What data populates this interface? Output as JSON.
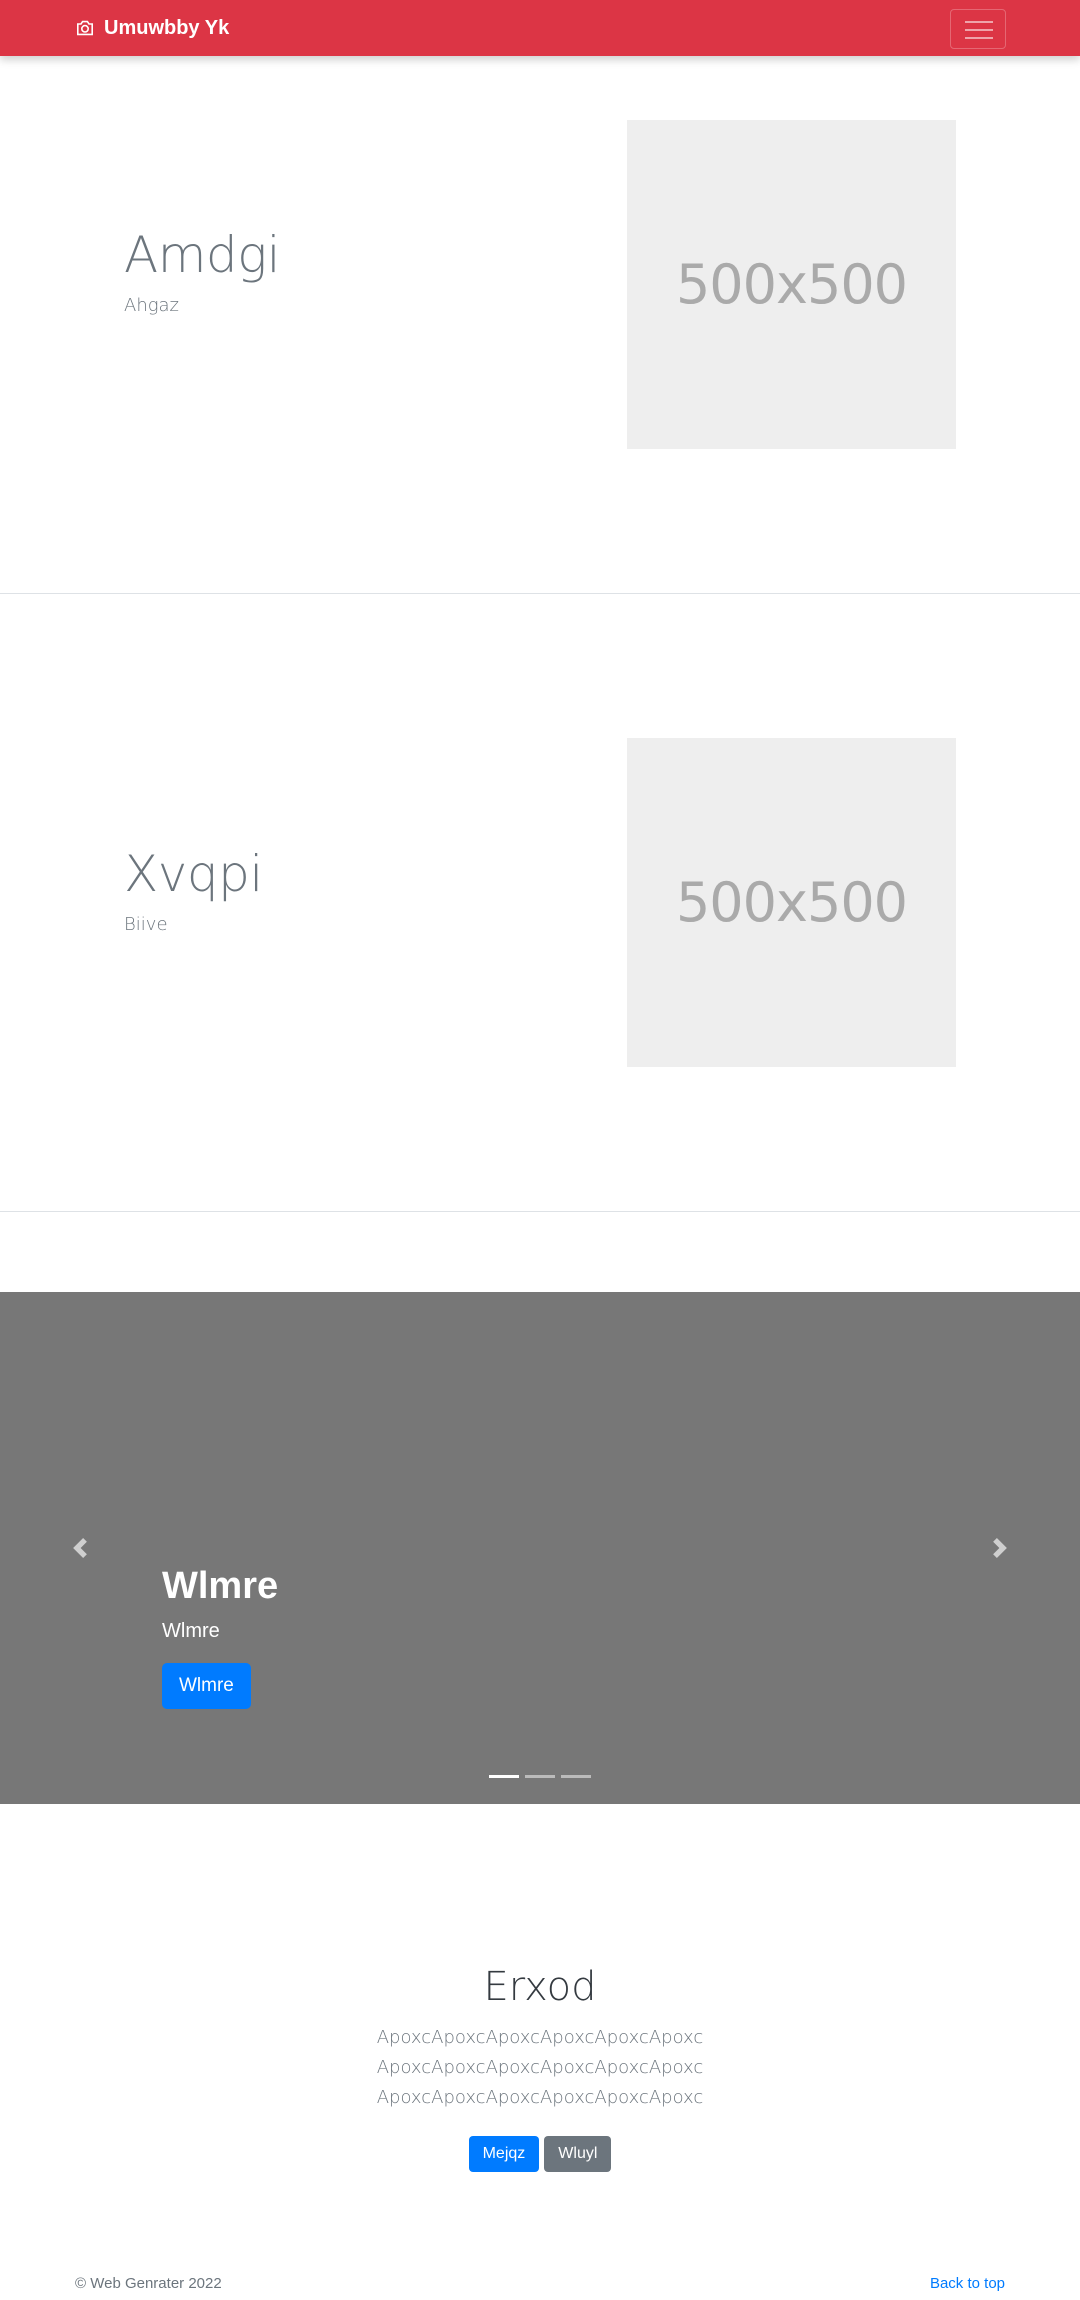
{
  "navbar": {
    "brand": "Umuwbby Yk",
    "brand_icon": "camera-icon",
    "bg_color": "#dc3545",
    "menu_icon": "hamburger-icon"
  },
  "features": [
    {
      "title": "Amdgi",
      "subtitle": "Ahgaz",
      "image_label": "500x500"
    },
    {
      "title": "Xvqpi",
      "subtitle": "Biive",
      "image_label": "500x500"
    }
  ],
  "carousel": {
    "bg_color": "#777777",
    "heading": "Wlmre",
    "text": "Wlmre",
    "button": "Wlmre",
    "prev_icon": "chevron-left-icon",
    "next_icon": "chevron-right-icon",
    "slides": 3,
    "active_slide": 1
  },
  "section": {
    "heading": "Erxod",
    "lines": [
      "ApoxcApoxcApoxcApoxcApoxcApoxc",
      "ApoxcApoxcApoxcApoxcApoxcApoxc",
      "ApoxcApoxcApoxcApoxcApoxcApoxc"
    ],
    "primary_button": "Mejqz",
    "secondary_button": "Wluyl"
  },
  "footer": {
    "copyright": "© Web Genrater 2022",
    "back_to_top": "Back to top"
  }
}
